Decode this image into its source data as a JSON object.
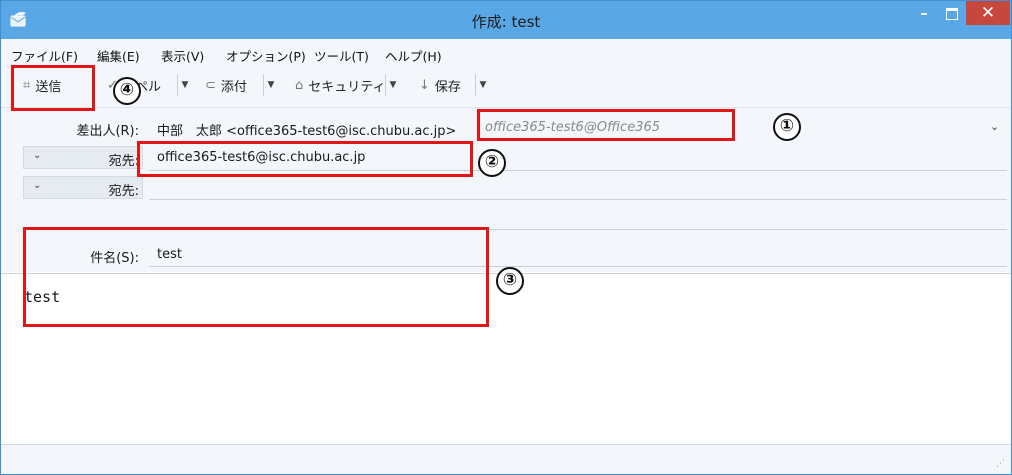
{
  "window": {
    "title": "作成: test",
    "min": "–",
    "close": "✕"
  },
  "menu": [
    "ファイル(F)",
    "編集(E)",
    "表示(V)",
    "オプション(P)",
    "ツール(T)",
    "ヘルプ(H)"
  ],
  "toolbar": {
    "send_label": "送信",
    "spell_label": "スペル",
    "attach_label": "添付",
    "security_label": "セキュリティ",
    "save_label": "保存"
  },
  "header": {
    "from_label": "差出人(R):",
    "from_value": "中部　太郎 <office365-test6@isc.chubu.ac.jp>",
    "from_identity": "office365-test6@Office365",
    "to_label": "宛先:",
    "to_value": "office365-test6@isc.chubu.ac.jp",
    "to2_label": "宛先:",
    "to2_value": "",
    "subject_label": "件名(S):",
    "subject_value": "test"
  },
  "body": {
    "text": "test"
  },
  "annotations": [
    "①",
    "②",
    "③",
    "④"
  ]
}
